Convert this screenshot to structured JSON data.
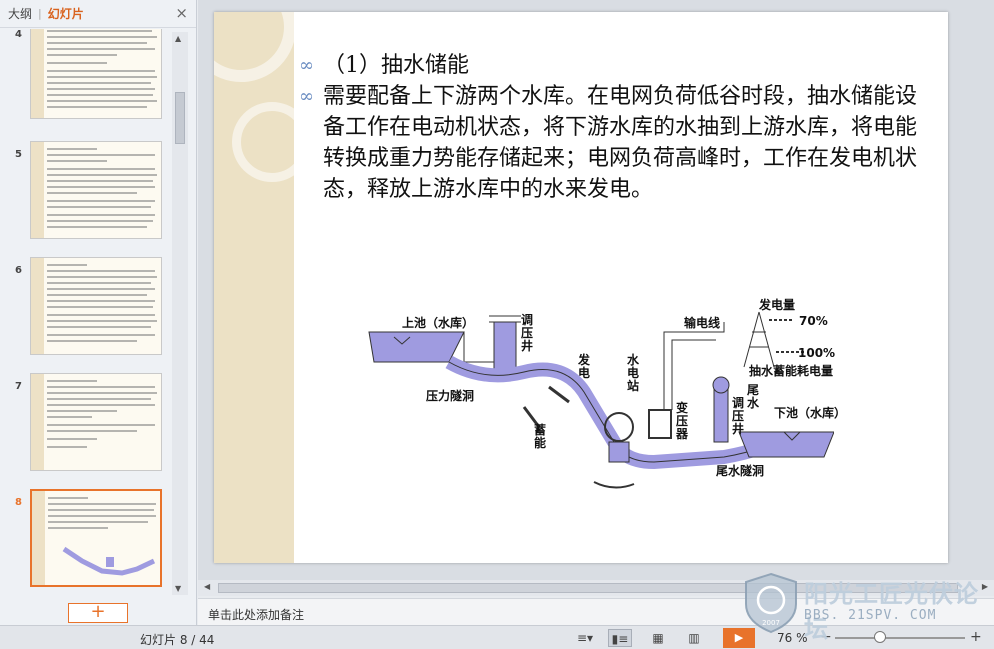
{
  "panel": {
    "tab_outline": "大纲",
    "tab_slides": "幻灯片",
    "close": "×",
    "slides": [
      {
        "num": "4"
      },
      {
        "num": "5"
      },
      {
        "num": "6"
      },
      {
        "num": "7"
      },
      {
        "num": "8",
        "selected": true
      }
    ],
    "add_button": "+"
  },
  "slide": {
    "bullets": [
      "（1）抽水储能",
      "需要配备上下游两个水库。在电网负荷低谷时段，抽水储能设备工作在电动机状态，将下游水库的水抽到上游水库，将电能转换成重力势能存储起来；电网负荷高峰时，工作在发电机状态，释放上游水库中的水来发电。"
    ],
    "diagram": {
      "upper_pool": "上池（水库）",
      "surge_shaft_1": "调压井",
      "penstock": "压力隧洞",
      "generate": "发电",
      "store": "蓄能",
      "station": "水电站",
      "transformer": "变压器",
      "surge_shaft_2": "调压井",
      "tailwater": "尾水",
      "tail_tunnel": "尾水隧洞",
      "lower_pool": "下池（水库）",
      "power_line": "输电线",
      "generation": "发电量",
      "pct_70": "70%",
      "pct_100": "100%",
      "pump_consumption": "抽水蓄能耗电量"
    }
  },
  "notes_placeholder": "单击此处添加备注",
  "status": {
    "slide_count": "幻灯片 8 / 44",
    "zoom": "76 %"
  },
  "watermark": {
    "title": "阳光工匠光伏论坛",
    "url": "BBS. 21SPV. COM",
    "year": "2007"
  },
  "colors": {
    "accent": "#e8732b",
    "water": "#9f9be0",
    "slide_strip": "#ece1c5"
  }
}
